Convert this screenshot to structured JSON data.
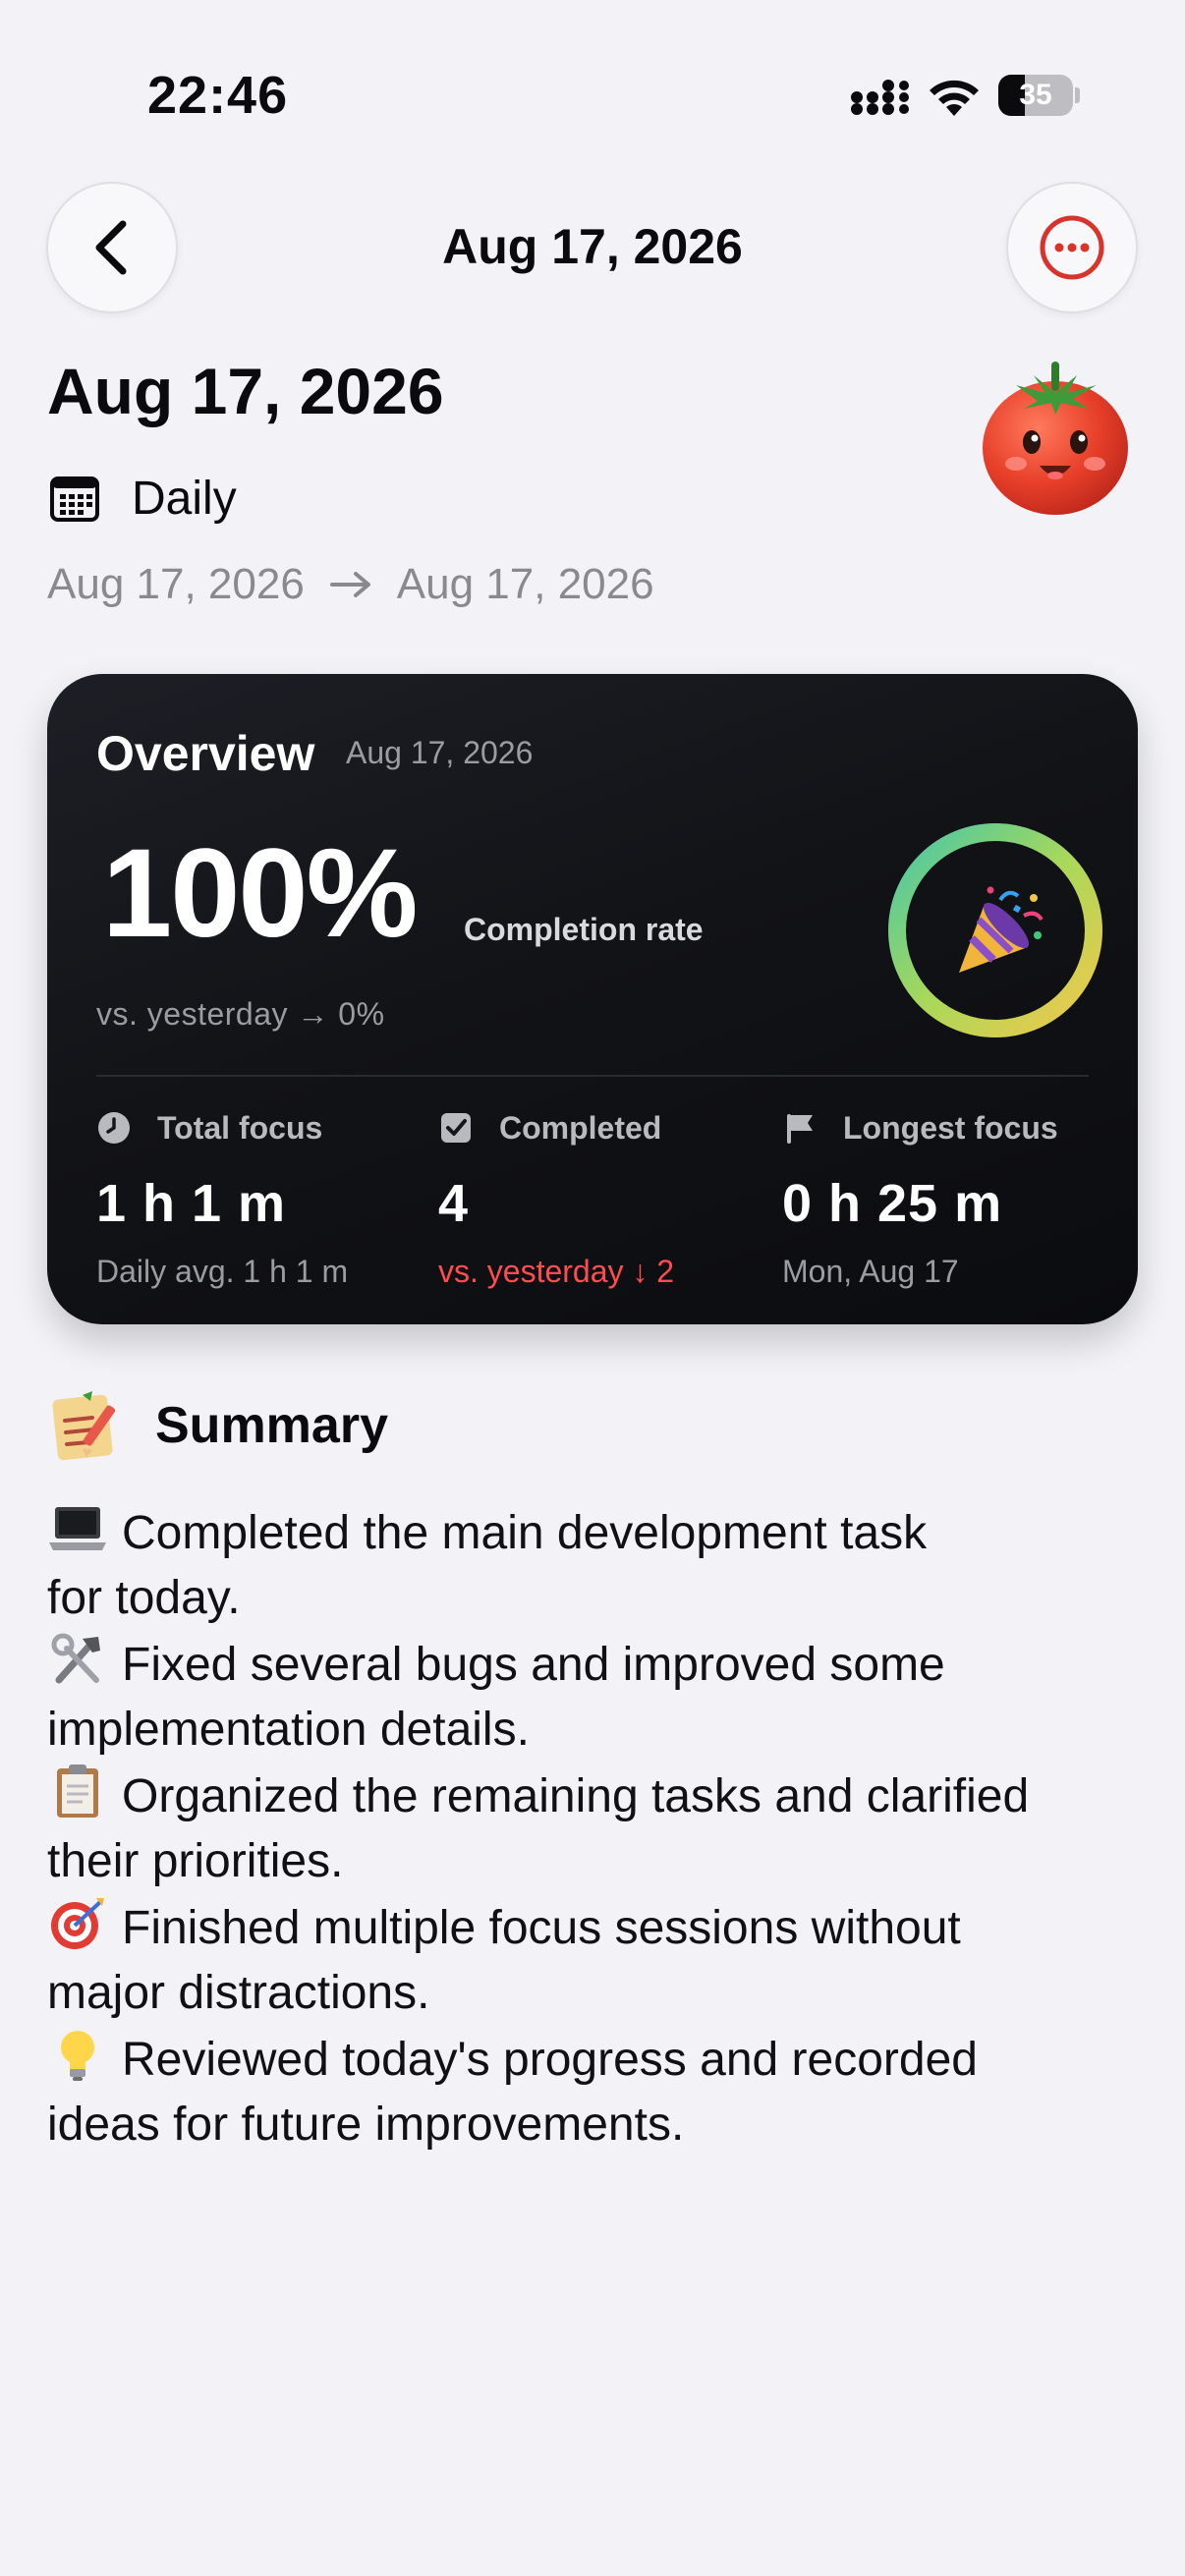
{
  "status_bar": {
    "time": "22:46",
    "battery_level": "35",
    "battery_fraction": 0.35,
    "icons": [
      "signal-icon",
      "wifi-icon",
      "battery-icon"
    ]
  },
  "nav": {
    "title": "Aug 17, 2026",
    "back_icon": "chevron-left-icon",
    "more_icon": "ellipsis-circle-icon",
    "accent": "#d8342c"
  },
  "header": {
    "title": "Aug 17, 2026",
    "mascot_icon": "tomato-icon",
    "period_icon": "calendar-icon",
    "period_label": "Daily",
    "range_start": "Aug 17, 2026",
    "range_arrow": "→",
    "range_end": "Aug 17, 2026"
  },
  "overview": {
    "title": "Overview",
    "date": "Aug 17, 2026",
    "completion_rate": "100%",
    "completion_fraction": 1.0,
    "completion_label": "Completion rate",
    "vs_yesterday": "vs. yesterday → 0%",
    "ring_icon": "party-popper-icon",
    "stats": [
      {
        "icon": "clock-icon",
        "label": "Total focus",
        "value": "1 h 1 m",
        "sub": "Daily avg. 1 h 1 m",
        "sub_color": "#9b9ca3"
      },
      {
        "icon": "checkbox-icon",
        "label": "Completed",
        "value": "4",
        "sub": "vs. yesterday ↓ 2",
        "sub_color": "#ff4d4f"
      },
      {
        "icon": "flag-icon",
        "label": "Longest focus",
        "value": "0 h 25 m",
        "sub": "Mon, Aug 17",
        "sub_color": "#9b9ca3"
      }
    ]
  },
  "summary": {
    "icon": "memo-icon",
    "title": "Summary",
    "lines": [
      {
        "icon": "laptop-icon",
        "text_a": "Completed the main development task",
        "text_b": "for today."
      },
      {
        "icon": "hammer-wrench-icon",
        "text_a": "Fixed several bugs and improved some",
        "text_b": "implementation details."
      },
      {
        "icon": "clipboard-icon",
        "text_a": "Organized the remaining tasks and clarified",
        "text_b": "their priorities."
      },
      {
        "icon": "target-icon",
        "text_a": "Finished multiple focus sessions without",
        "text_b": "major distractions."
      },
      {
        "icon": "light-bulb-icon",
        "text_a": "Reviewed today's progress and recorded",
        "text_b": "ideas for future improvements."
      }
    ]
  }
}
